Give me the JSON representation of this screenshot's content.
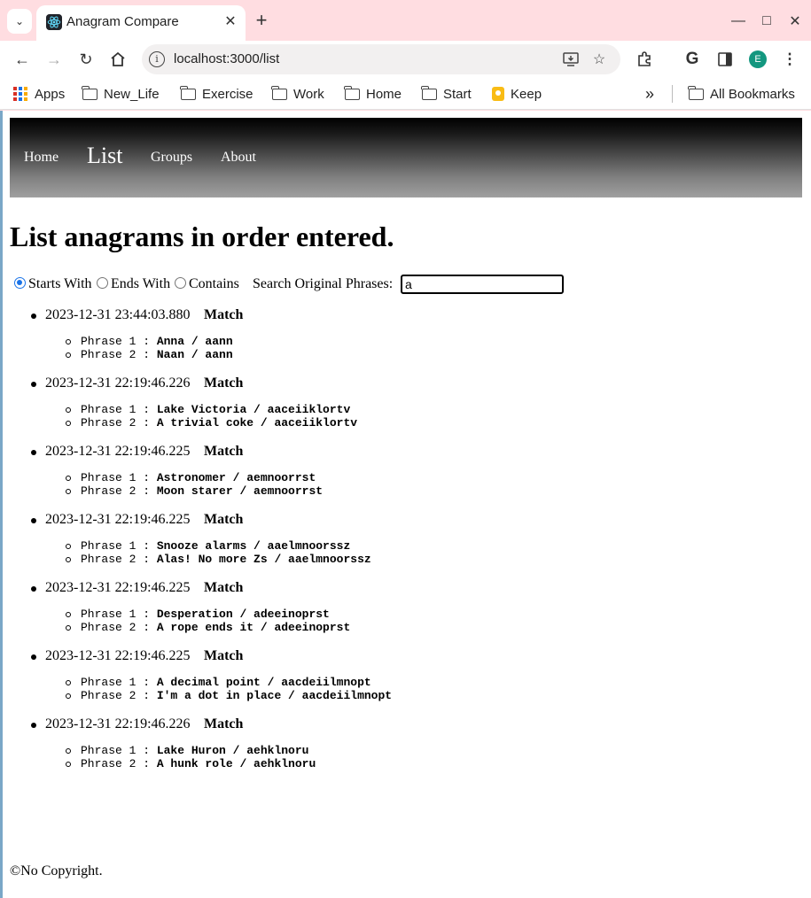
{
  "browser": {
    "tab_title": "Anagram Compare",
    "url": "localhost:3000/list",
    "profile_initial": "E",
    "bookmarks": [
      "Apps",
      "New_Life",
      "Exercise",
      "Work",
      "Home",
      "Start",
      "Keep"
    ],
    "all_bookmarks": "All Bookmarks"
  },
  "nav": {
    "home": "Home",
    "list": "List",
    "groups": "Groups",
    "about": "About"
  },
  "page": {
    "title": "List anagrams in order entered."
  },
  "filters": {
    "starts_with": "Starts With",
    "ends_with": "Ends With",
    "contains": "Contains",
    "selected": "Starts With",
    "search_label": "Search Original Phrases:",
    "search_value": "a"
  },
  "entries": [
    {
      "timestamp": "2023-12-31 23:44:03.880",
      "status": "Match",
      "phrase1": "Anna / aann",
      "phrase2": "Naan / aann"
    },
    {
      "timestamp": "2023-12-31 22:19:46.226",
      "status": "Match",
      "phrase1": "Lake Victoria / aaceiiklortv",
      "phrase2": "A trivial coke / aaceiiklortv"
    },
    {
      "timestamp": "2023-12-31 22:19:46.225",
      "status": "Match",
      "phrase1": "Astronomer / aemnoorrst",
      "phrase2": "Moon starer / aemnoorrst"
    },
    {
      "timestamp": "2023-12-31 22:19:46.225",
      "status": "Match",
      "phrase1": "Snooze alarms / aaelmnoorssz",
      "phrase2": "Alas! No more Zs / aaelmnoorssz"
    },
    {
      "timestamp": "2023-12-31 22:19:46.225",
      "status": "Match",
      "phrase1": "Desperation / adeeinoprst",
      "phrase2": "A rope ends it / adeeinoprst"
    },
    {
      "timestamp": "2023-12-31 22:19:46.225",
      "status": "Match",
      "phrase1": "A decimal point / aacdeiilmnopt",
      "phrase2": "I'm a dot in place / aacdeiilmnopt"
    },
    {
      "timestamp": "2023-12-31 22:19:46.226",
      "status": "Match",
      "phrase1": "Lake Huron / aehklnoru",
      "phrase2": "A hunk role / aehklnoru"
    }
  ],
  "phrase_labels": {
    "p1": "Phrase 1 : ",
    "p2": "Phrase 2 : "
  },
  "footer": "©No Copyright."
}
